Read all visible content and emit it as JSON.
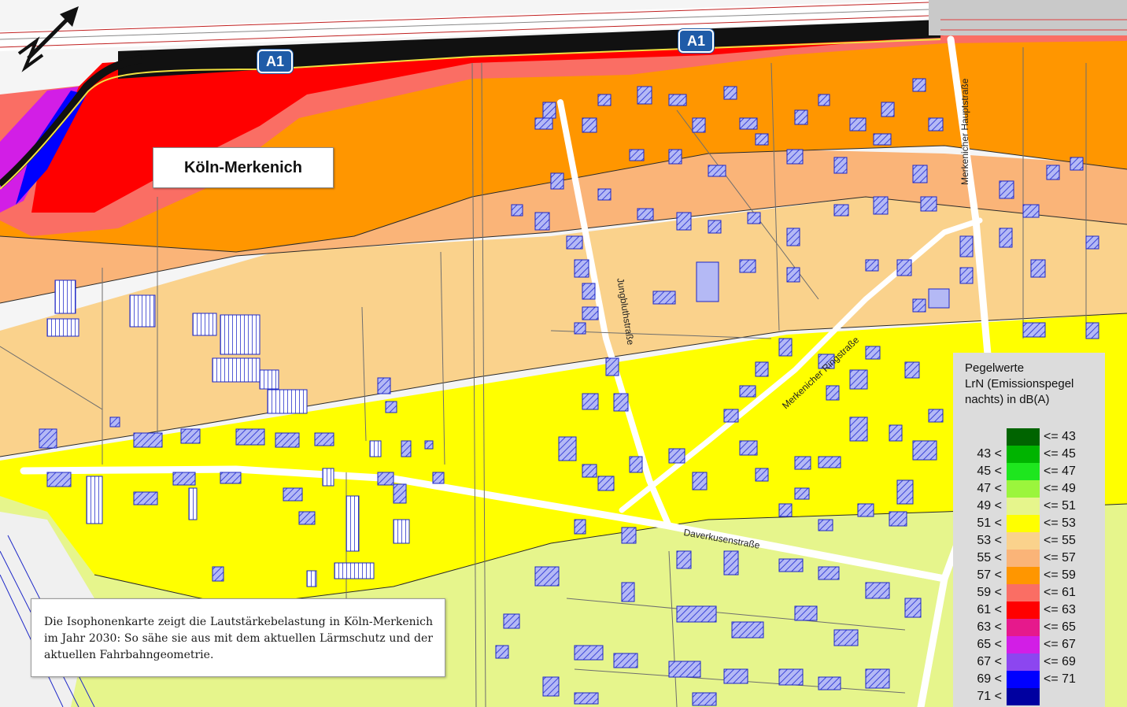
{
  "map": {
    "place_label": "Köln-Merkenich",
    "motorway_shields": [
      "A1",
      "A1"
    ],
    "streets": {
      "jungbluth": "Jungbluthstraße",
      "ring": "Merkenicher Ringstraße",
      "hauptstr": "Merkenicher Hauptstraße",
      "daverkusen": "Daverkusenstraße"
    },
    "north_arrow": "north-arrow-icon",
    "caption": "Die Isophonenkarte zeigt die Lautstärkebelastung in Köln-Merkenich im Jahr 2030: So sähe sie aus mit dem aktuellen Lärmschutz und der aktuellen Fahrbahngeometrie."
  },
  "legend": {
    "title_lines": [
      "Pegelwerte",
      "LrN (Emissionspegel",
      "nachts) in dB(A)"
    ],
    "classes": [
      {
        "lower": "",
        "upper": "<= 43",
        "color": "#006400"
      },
      {
        "lower": "43 <",
        "upper": "<= 45",
        "color": "#00b400"
      },
      {
        "lower": "45 <",
        "upper": "<= 47",
        "color": "#1ee61e"
      },
      {
        "lower": "47 <",
        "upper": "<= 49",
        "color": "#9bf53c"
      },
      {
        "lower": "49 <",
        "upper": "<= 51",
        "color": "#e6f58c"
      },
      {
        "lower": "51 <",
        "upper": "<= 53",
        "color": "#ffff00"
      },
      {
        "lower": "53 <",
        "upper": "<= 55",
        "color": "#fad28c"
      },
      {
        "lower": "55 <",
        "upper": "<= 57",
        "color": "#fab478"
      },
      {
        "lower": "57 <",
        "upper": "<= 59",
        "color": "#ff9600"
      },
      {
        "lower": "59 <",
        "upper": "<= 61",
        "color": "#fa6e64"
      },
      {
        "lower": "61 <",
        "upper": "<= 63",
        "color": "#ff0000"
      },
      {
        "lower": "63 <",
        "upper": "<= 65",
        "color": "#e6198c"
      },
      {
        "lower": "65 <",
        "upper": "<= 67",
        "color": "#d21ee6"
      },
      {
        "lower": "67 <",
        "upper": "<= 69",
        "color": "#8c46f0"
      },
      {
        "lower": "69 <",
        "upper": "<= 71",
        "color": "#0000ff"
      },
      {
        "lower": "71 <",
        "upper": "",
        "color": "#0000a0"
      }
    ]
  },
  "colors": {
    "building_fill": "#b4b9f5",
    "building_outline": "#1e28c8",
    "road": "#ffffff",
    "motorway": "#000000"
  }
}
